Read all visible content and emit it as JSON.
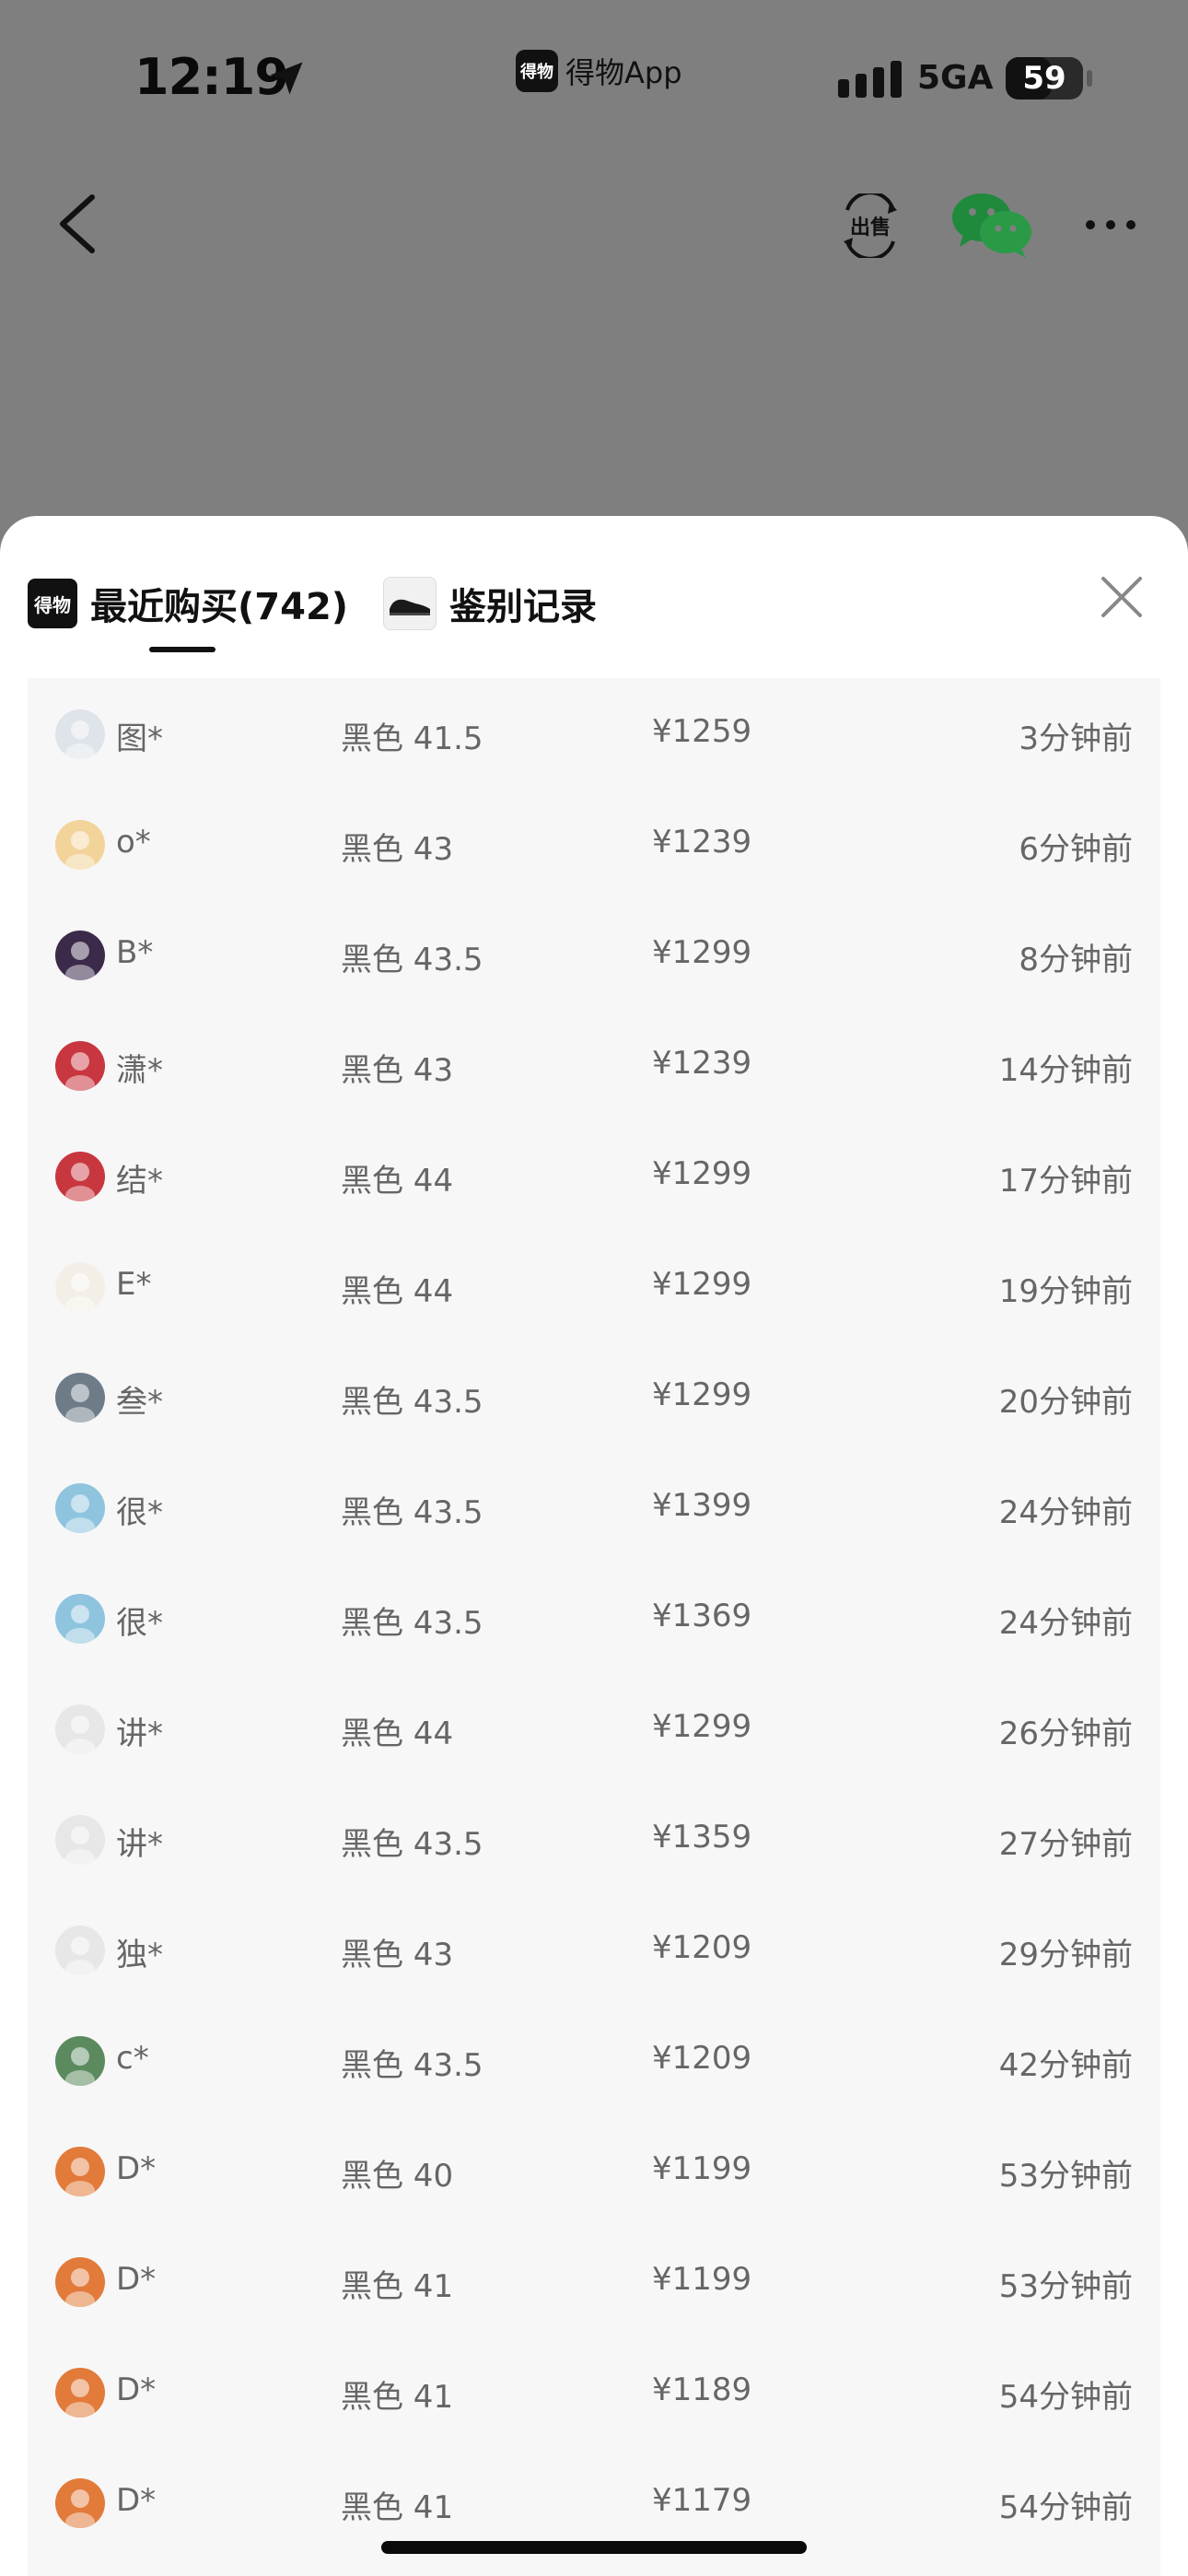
{
  "status_bar": {
    "time": "12:19",
    "app_name": "得物App",
    "app_logo_text": "得物",
    "network": "5GA",
    "battery": "59",
    "battery_level": 0.59
  },
  "nav": {
    "icons": [
      "back-icon",
      "sell-icon",
      "wechat-icon",
      "more-icon"
    ],
    "sell_label": "出售"
  },
  "sheet": {
    "tabs": [
      {
        "label": "最近购买(742)",
        "icon": "dewu-logo",
        "logo_text": "得物",
        "selected": true
      },
      {
        "label": "鉴别记录",
        "icon": "shoe-thumbnail",
        "selected": false
      }
    ],
    "close_icon": "close-icon"
  },
  "purchases": [
    {
      "user": "图*",
      "spec": "黑色 41.5",
      "price": "¥1259",
      "ago": "3分钟前",
      "avatar_color": "#dfe3ea"
    },
    {
      "user": "o*",
      "spec": "黑色 43",
      "price": "¥1239",
      "ago": "6分钟前",
      "avatar_color": "#f2d49a"
    },
    {
      "user": "B*",
      "spec": "黑色 43.5",
      "price": "¥1299",
      "ago": "8分钟前",
      "avatar_color": "#3b2a4a"
    },
    {
      "user": "潇*",
      "spec": "黑色 43",
      "price": "¥1239",
      "ago": "14分钟前",
      "avatar_color": "#c8373f"
    },
    {
      "user": "结*",
      "spec": "黑色 44",
      "price": "¥1299",
      "ago": "17分钟前",
      "avatar_color": "#c8373f"
    },
    {
      "user": "E*",
      "spec": "黑色 44",
      "price": "¥1299",
      "ago": "19分钟前",
      "avatar_color": "#f3efe6"
    },
    {
      "user": "叁*",
      "spec": "黑色 43.5",
      "price": "¥1299",
      "ago": "20分钟前",
      "avatar_color": "#6e7c88"
    },
    {
      "user": "很*",
      "spec": "黑色 43.5",
      "price": "¥1399",
      "ago": "24分钟前",
      "avatar_color": "#8ec4dd"
    },
    {
      "user": "很*",
      "spec": "黑色 43.5",
      "price": "¥1369",
      "ago": "24分钟前",
      "avatar_color": "#8ec4dd"
    },
    {
      "user": "讲*",
      "spec": "黑色 44",
      "price": "¥1299",
      "ago": "26分钟前",
      "avatar_color": "#e7e7e7"
    },
    {
      "user": "讲*",
      "spec": "黑色 43.5",
      "price": "¥1359",
      "ago": "27分钟前",
      "avatar_color": "#e7e7e7"
    },
    {
      "user": "独*",
      "spec": "黑色 43",
      "price": "¥1209",
      "ago": "29分钟前",
      "avatar_color": "#e7e7e7"
    },
    {
      "user": "c*",
      "spec": "黑色 43.5",
      "price": "¥1209",
      "ago": "42分钟前",
      "avatar_color": "#5c8a5f"
    },
    {
      "user": "D*",
      "spec": "黑色 40",
      "price": "¥1199",
      "ago": "53分钟前",
      "avatar_color": "#e27a3a"
    },
    {
      "user": "D*",
      "spec": "黑色 41",
      "price": "¥1199",
      "ago": "53分钟前",
      "avatar_color": "#e27a3a"
    },
    {
      "user": "D*",
      "spec": "黑色 41",
      "price": "¥1189",
      "ago": "54分钟前",
      "avatar_color": "#e27a3a"
    },
    {
      "user": "D*",
      "spec": "黑色 41",
      "price": "¥1179",
      "ago": "54分钟前",
      "avatar_color": "#e27a3a"
    }
  ]
}
